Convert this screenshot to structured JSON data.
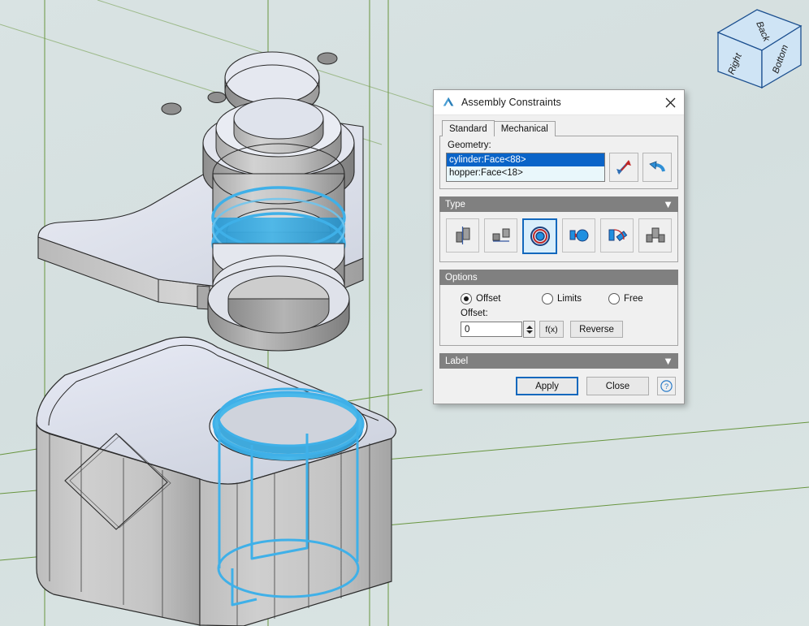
{
  "viewport": {
    "background_color": "#d6e1e1",
    "grid_line_color": "#5f8f32",
    "model_face_color": "#c8c8c8",
    "highlight_color": "#33a9e0",
    "edge_color": "#1a1a1a"
  },
  "viewcube": {
    "top_face_label": "Back",
    "left_face_label": "Right",
    "right_face_label": "Bottom",
    "fill_color": "#cfe4f5",
    "edge_color": "#1b4f8f"
  },
  "dialog": {
    "title": "Assembly Constraints",
    "title_icon": "autodesk-a-icon",
    "close_icon": "close-icon",
    "tabs": [
      {
        "label": "Standard",
        "active": true
      },
      {
        "label": "Mechanical",
        "active": false
      }
    ],
    "geometry": {
      "label": "Geometry:",
      "items": [
        {
          "text": "cylinder:Face<88>",
          "selected": true
        },
        {
          "text": "hopper:Face<18>",
          "selected": false
        }
      ],
      "swap_icon": "swap-arrows-icon",
      "undo_icon": "undo-arrow-icon"
    },
    "type_section": {
      "label": "Type",
      "chevron": "▼",
      "buttons": [
        {
          "name": "mate-constraint",
          "selected": false
        },
        {
          "name": "flush-constraint",
          "selected": false
        },
        {
          "name": "concentric-constraint",
          "selected": true
        },
        {
          "name": "tangent-constraint",
          "selected": false
        },
        {
          "name": "perpendicular-constraint",
          "selected": false
        },
        {
          "name": "symmetric-constraint",
          "selected": false
        }
      ]
    },
    "options_section": {
      "label": "Options",
      "radios": [
        {
          "label": "Offset",
          "checked": true
        },
        {
          "label": "Limits",
          "checked": false
        },
        {
          "label": "Free",
          "checked": false
        }
      ],
      "offset_label": "Offset:",
      "offset_value": "0",
      "fx_label": "f(x)",
      "reverse_label": "Reverse"
    },
    "label_section": {
      "label": "Label",
      "chevron": "▼"
    },
    "footer": {
      "apply_label": "Apply",
      "close_label": "Close",
      "help_label": "?"
    },
    "accent_color": "#1368bd",
    "selection_color": "#0a64c8"
  }
}
